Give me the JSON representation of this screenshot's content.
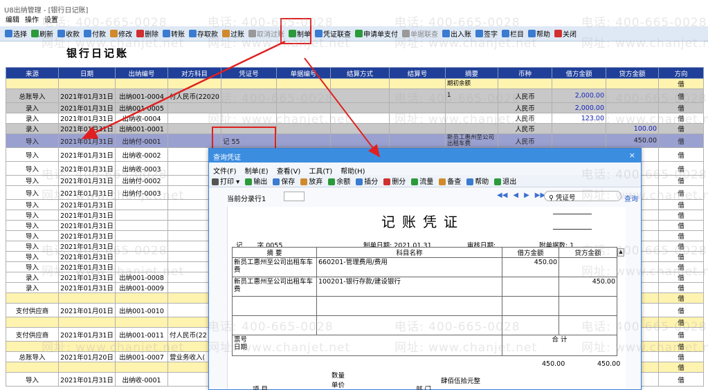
{
  "window": {
    "title": "U8出纳管理 - [银行日记账]"
  },
  "menu": [
    "编辑",
    "操作",
    "设置"
  ],
  "toolbar": [
    {
      "label": "选择",
      "icon": "select-icon",
      "color": "#3b7bd0"
    },
    {
      "label": "刷新",
      "icon": "refresh-icon",
      "color": "#2c9a3a"
    },
    {
      "label": "收款",
      "icon": "receive-icon",
      "color": "#3b7bd0"
    },
    {
      "label": "付款",
      "icon": "pay-icon",
      "color": "#3b7bd0"
    },
    {
      "label": "修改",
      "icon": "edit-icon",
      "color": "#d08a2c"
    },
    {
      "label": "删除",
      "icon": "delete-icon",
      "color": "#d03030"
    },
    {
      "label": "转账",
      "icon": "transfer-icon",
      "color": "#3b7bd0"
    },
    {
      "label": "存取款",
      "icon": "deposit-icon",
      "color": "#3b7bd0"
    },
    {
      "label": "过账",
      "icon": "post-icon",
      "color": "#d08a2c"
    },
    {
      "label": "取消过账",
      "icon": "unpost-icon",
      "color": "#999999",
      "disabled": true
    },
    {
      "label": "制单",
      "icon": "make-voucher-icon",
      "color": "#2c9a3a"
    },
    {
      "label": "凭证联查",
      "icon": "voucher-query-icon",
      "color": "#3b7bd0"
    },
    {
      "label": "申请单支付",
      "icon": "apply-pay-icon",
      "color": "#2c9a3a"
    },
    {
      "label": "单据联查",
      "icon": "doc-query-icon",
      "color": "#999999",
      "disabled": true
    },
    {
      "label": "出入账",
      "icon": "in-out-icon",
      "color": "#3b7bd0"
    },
    {
      "label": "签字",
      "icon": "sign-icon",
      "color": "#3b7bd0"
    },
    {
      "label": "栏目",
      "icon": "columns-icon",
      "color": "#3b7bd0"
    },
    {
      "label": "帮助",
      "icon": "help-icon",
      "color": "#3b7bd0"
    },
    {
      "label": "关闭",
      "icon": "close-icon",
      "color": "#d03030"
    }
  ],
  "page_title": "银行日记账",
  "ledger": {
    "columns": [
      "来源",
      "日期",
      "出纳编号",
      "对方科目",
      "凭证号",
      "单据编号",
      "结算方式",
      "结算号",
      "摘要",
      "币种",
      "借方金额",
      "贷方金额",
      "方向"
    ],
    "rows": [
      {
        "style": "yellow",
        "cells": [
          "",
          "",
          "",
          "",
          "",
          "",
          "",
          "",
          "期初余额",
          "",
          "",
          "",
          "借"
        ]
      },
      {
        "style": "gray tall",
        "cells": [
          "总账导入",
          "2021年01月31日",
          "出纳001-0004",
          "付人民币(22020",
          "",
          "",
          "",
          "",
          "1",
          "人民币",
          "2,000.00",
          "",
          "借"
        ]
      },
      {
        "style": "gray",
        "cells": [
          "录入",
          "2021年01月31日",
          "出纳001-0005",
          "",
          "",
          "",
          "",
          "",
          "",
          "人民币",
          "2,000.00",
          "",
          "借"
        ]
      },
      {
        "style": "white",
        "cells": [
          "录入",
          "2021年01月31日",
          "出纳收-0004",
          "",
          "",
          "",
          "",
          "",
          "",
          "人民币",
          "123.00",
          "",
          "借"
        ]
      },
      {
        "style": "gray",
        "cells": [
          "录入",
          "2021年01月31日",
          "出纳001-0001",
          "",
          "",
          "",
          "",
          "",
          "",
          "人民币",
          "",
          "100.00",
          "借"
        ]
      },
      {
        "style": "sel tall",
        "cells": [
          "导入",
          "2021年01月31日",
          "出纳付-0001",
          "",
          "记  55",
          "",
          "",
          "",
          "新员工惠州至公司出租车费",
          "人民币",
          "",
          "450.00",
          "借"
        ]
      },
      {
        "style": "white tall",
        "cells": [
          "导入",
          "2021年01月31日",
          "出纳收-0002",
          "",
          "",
          "",
          "",
          "",
          "",
          "",
          "",
          "",
          "借"
        ]
      },
      {
        "style": "white tall",
        "cells": [
          "导入",
          "2021年01月31日",
          "出纳收-0003",
          "",
          "",
          "",
          "",
          "",
          "",
          "",
          "",
          "",
          "借"
        ]
      },
      {
        "style": "white",
        "cells": [
          "导入",
          "2021年01月31日",
          "出纳付-0002",
          "",
          "",
          "",
          "",
          "",
          "",
          "",
          "",
          "",
          "借"
        ]
      },
      {
        "style": "white tall",
        "cells": [
          "导入",
          "2021年01月31日",
          "出纳付-0003",
          "",
          "",
          "",
          "",
          "",
          "",
          "",
          "",
          "",
          "借"
        ]
      },
      {
        "style": "white",
        "cells": [
          "导入",
          "2021年01月31日",
          "",
          "",
          "",
          "",
          "",
          "",
          "",
          "",
          "",
          "",
          "借"
        ]
      },
      {
        "style": "white",
        "cells": [
          "导入",
          "2021年01月31日",
          "",
          "",
          "",
          "",
          "",
          "",
          "",
          "",
          "",
          "",
          "借"
        ]
      },
      {
        "style": "white",
        "cells": [
          "导入",
          "2021年01月31日",
          "",
          "",
          "",
          "",
          "",
          "",
          "",
          "",
          "",
          "",
          "借"
        ]
      },
      {
        "style": "white",
        "cells": [
          "导入",
          "2021年01月31日",
          "",
          "",
          "",
          "",
          "",
          "",
          "",
          "",
          "",
          "",
          "借"
        ]
      },
      {
        "style": "white",
        "cells": [
          "导入",
          "2021年01月31日",
          "",
          "",
          "",
          "",
          "",
          "",
          "",
          "",
          "",
          "",
          "借"
        ]
      },
      {
        "style": "white",
        "cells": [
          "导入",
          "2021年01月31日",
          "",
          "",
          "",
          "",
          "",
          "",
          "",
          "",
          "",
          "",
          "借"
        ]
      },
      {
        "style": "white",
        "cells": [
          "导入",
          "2021年01月31日",
          "",
          "",
          "",
          "",
          "",
          "",
          "",
          "",
          "",
          "",
          "借"
        ]
      },
      {
        "style": "white",
        "cells": [
          "录入",
          "2021年01月31日",
          "出纳001-0008",
          "",
          "",
          "",
          "",
          "",
          "",
          "",
          "",
          "",
          "借"
        ]
      },
      {
        "style": "white",
        "cells": [
          "录入",
          "2021年01月31日",
          "出纳001-0009",
          "",
          "",
          "",
          "",
          "",
          "",
          "",
          "",
          "",
          "借"
        ]
      },
      {
        "style": "yellow",
        "cells": [
          "",
          "",
          "",
          "",
          "",
          "",
          "",
          "",
          "",
          "",
          "",
          "",
          "借"
        ]
      },
      {
        "style": "white tall",
        "cells": [
          "支付供应商",
          "2021年01月01日",
          "出纳001-0010",
          "",
          "",
          "",
          "",
          "",
          "",
          "",
          "",
          "",
          "借"
        ]
      },
      {
        "style": "yellow",
        "cells": [
          "",
          "",
          "",
          "",
          "",
          "",
          "",
          "",
          "",
          "",
          "",
          "",
          "借"
        ]
      },
      {
        "style": "white tall",
        "cells": [
          "支付供应商",
          "2021年01月31日",
          "出纳001-0011",
          "付人民币(22",
          "",
          "",
          "",
          "",
          "",
          "",
          "",
          "",
          "借"
        ]
      },
      {
        "style": "yellow",
        "cells": [
          "",
          "",
          "",
          "",
          "",
          "",
          "",
          "",
          "",
          "",
          "",
          "",
          "借"
        ]
      },
      {
        "style": "white",
        "cells": [
          "总账导入",
          "2021年01月20日",
          "出纳001-0007",
          "营业务收入(",
          "",
          "",
          "",
          "",
          "",
          "",
          "",
          "",
          "借"
        ]
      },
      {
        "style": "yellow",
        "cells": [
          "",
          "",
          "",
          "",
          "",
          "",
          "",
          "",
          "",
          "",
          "",
          "",
          "借"
        ]
      },
      {
        "style": "white tall",
        "cells": [
          "导入",
          "2021年01月31日",
          "出纳收-0001",
          "",
          "",
          "",
          "",
          "",
          "",
          "",
          "",
          "",
          "借"
        ]
      }
    ]
  },
  "dialog": {
    "title": "查询凭证",
    "close": "×",
    "menu": [
      "文件(F)",
      "制单(E)",
      "查看(V)",
      "工具(T)",
      "帮助(H)"
    ],
    "tools": [
      {
        "label": "打印 ▾",
        "icon": "print-icon",
        "color": "#555555"
      },
      {
        "label": "输出",
        "icon": "export-icon",
        "color": "#2c9a3a"
      },
      {
        "label": "保存",
        "icon": "save-icon",
        "color": "#3b7bd0"
      },
      {
        "label": "放弃",
        "icon": "discard-icon",
        "color": "#d08a2c"
      },
      {
        "label": "余额",
        "icon": "balance-icon",
        "color": "#2c9a3a"
      },
      {
        "label": "插分",
        "icon": "insert-icon",
        "color": "#3b7bd0"
      },
      {
        "label": "删分",
        "icon": "delete-line-icon",
        "color": "#d03030"
      },
      {
        "label": "流量",
        "icon": "flow-icon",
        "color": "#2c9a3a"
      },
      {
        "label": "备查",
        "icon": "memo-icon",
        "color": "#d08a2c"
      },
      {
        "label": "帮助",
        "icon": "help-icon",
        "color": "#3b7bd0"
      },
      {
        "label": "退出",
        "icon": "exit-icon",
        "color": "#2c9a3a"
      }
    ],
    "current_entry_label": "当前分录行1",
    "search_placeholder": "凭证号",
    "query_label": "查询",
    "voucher": {
      "title": "记账凭证",
      "type": "记",
      "zi": "字",
      "number": "0055",
      "date_label": "制单日期:",
      "date": "2021.01.31",
      "audit_label": "审核日期:",
      "attach_label": "附单据数:",
      "attach_count": "1",
      "headers": [
        "摘 要",
        "科目名称",
        "借方金额",
        "贷方金额"
      ],
      "lines": [
        {
          "summary": "新员工惠州至公司出租车车费",
          "account": "660201-管理费用/费用",
          "debit": "450.00",
          "credit": ""
        },
        {
          "summary": "新员工惠州至公司出租车车费",
          "account": "100201-银行存款/建设银行",
          "debit": "",
          "credit": "450.00"
        },
        {
          "summary": "",
          "account": "",
          "debit": "",
          "credit": ""
        },
        {
          "summary": "",
          "account": "",
          "debit": "",
          "credit": ""
        }
      ],
      "ticket_label": "票号",
      "ticket_date_label": "日期",
      "qty_label": "数量",
      "price_label": "单价",
      "total_label": "合 计",
      "total_words": "肆佰伍拾元整",
      "total_debit": "450.00",
      "total_credit": "450.00",
      "project_label": "项  目",
      "dept_label": "部  门"
    }
  },
  "watermark": {
    "phone": "电话: 400-665-0028",
    "site": "网址: www.chanjet.net"
  }
}
